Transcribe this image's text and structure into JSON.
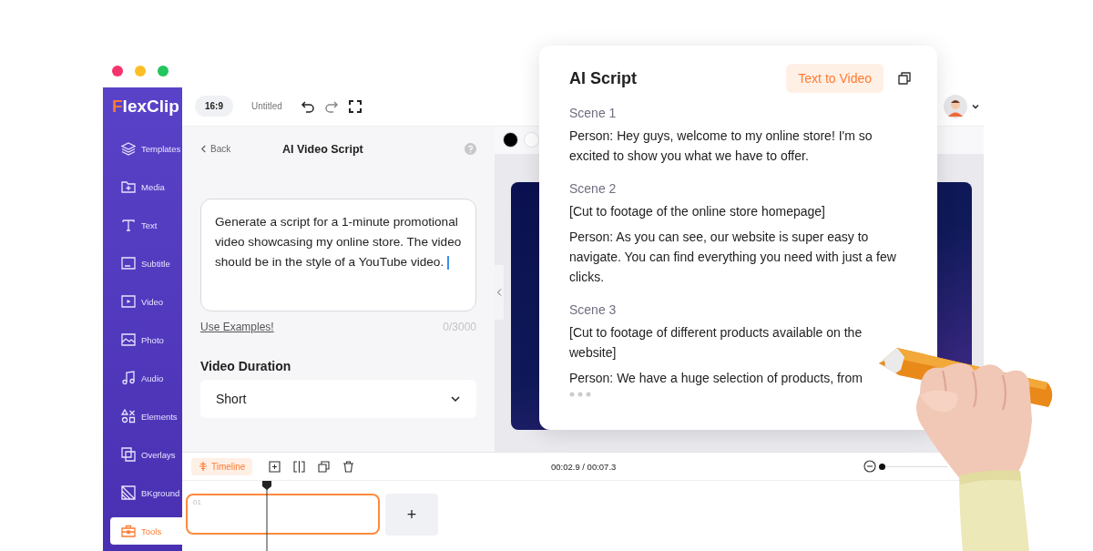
{
  "window": {
    "controls": [
      {
        "color": "#f5336d"
      },
      {
        "color": "#fbbf24"
      },
      {
        "color": "#22c55e"
      }
    ]
  },
  "sidebar": {
    "logo": "FlexClip",
    "items": [
      {
        "label": "Templates",
        "selected": false
      },
      {
        "label": "Media",
        "selected": false
      },
      {
        "label": "Text",
        "selected": false
      },
      {
        "label": "Subtitle",
        "selected": false
      },
      {
        "label": "Video",
        "selected": false
      },
      {
        "label": "Photo",
        "selected": false
      },
      {
        "label": "Audio",
        "selected": false
      },
      {
        "label": "Elements",
        "selected": false
      },
      {
        "label": "Overlays",
        "selected": false
      },
      {
        "label": "BKground",
        "selected": false
      },
      {
        "label": "Tools",
        "selected": true
      }
    ]
  },
  "topbar": {
    "ratio": "16:9",
    "title": "Untitled"
  },
  "panel": {
    "back": "Back",
    "title": "AI Video Script",
    "prompt": "Generate a script for a 1-minute promotional video showcasing my online store. The video should be in the style of a YouTube video.",
    "examples_link": "Use Examples!",
    "counter": "0/3000",
    "duration_label": "Video Duration",
    "duration_value": "Short"
  },
  "canvas": {
    "swatches": [
      {
        "color": "#000000"
      },
      {
        "color": "#ffffff"
      }
    ]
  },
  "timeline": {
    "tab": "Timeline",
    "time": "00:02.9 / 00:07.3",
    "clips": [
      {
        "label": "01",
        "selected": true
      }
    ],
    "add": "+",
    "zoom": {
      "level": 0
    }
  },
  "ai_script": {
    "title": "AI Script",
    "action": "Text to Video",
    "scenes": [
      {
        "heading": "Scene 1",
        "lines": [
          "Person: Hey guys, welcome to my online store! I'm so excited to show you what we have to offer."
        ]
      },
      {
        "heading": "Scene 2",
        "lines": [
          "[Cut to footage of the online store homepage]",
          "Person: As you can see, our website is super easy to navigate. You can find everything you need with just a few clicks."
        ]
      },
      {
        "heading": "Scene 3",
        "lines": [
          "[Cut to footage of different products available on the website]",
          "Person: We have a huge selection of products, from"
        ]
      }
    ],
    "loading": true
  }
}
